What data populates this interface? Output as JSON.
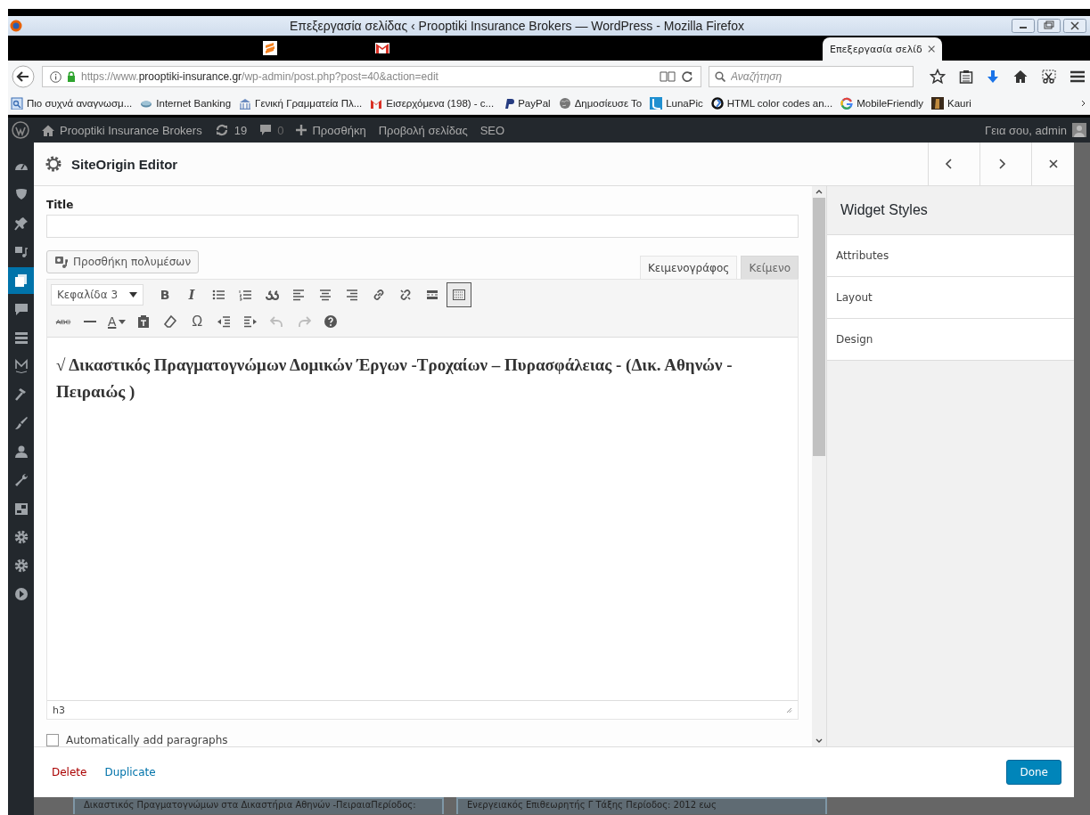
{
  "window": {
    "title": "Επεξεργασία σελίδας ‹ Prooptiki Insurance Brokers — WordPress - Mozilla Firefox"
  },
  "pinned_tabs": [
    {
      "kind": "sublime"
    },
    {
      "kind": "mail"
    }
  ],
  "tabs": [
    {
      "label": "Επεξεργασία σελίδ",
      "selected": true
    }
  ],
  "address_bar": {
    "url": "https://www.**prooptiki-insurance.gr**/wp-admin/post.php?post=40&action=edit"
  },
  "search": {
    "placeholder": "Αναζήτηση"
  },
  "bookmarks": [
    {
      "label": "Πιο συχνά αναγνωσμ...",
      "kind": "page"
    },
    {
      "label": "Internet Banking",
      "kind": "disk"
    },
    {
      "label": "Γενική Γραμματεία Πλ...",
      "kind": "building"
    },
    {
      "label": "Εισερχόμενα (198) - c...",
      "kind": "mail"
    },
    {
      "label": "PayPal",
      "kind": "paypal"
    },
    {
      "label": "Δημοσίευσε Το",
      "kind": "globe"
    },
    {
      "label": "LunaPic",
      "kind": "luna"
    },
    {
      "label": "HTML color codes an...",
      "kind": "ring"
    },
    {
      "label": "MobileFriendly",
      "kind": "google"
    },
    {
      "label": "Kauri",
      "kind": "photo"
    }
  ],
  "admin_bar": {
    "site": "Prooptiki Insurance Brokers",
    "updates": "19",
    "comments": "0",
    "new": "Προσθήκη",
    "view": "Προβολή σελίδας",
    "seo": "SEO",
    "greeting": "Γεια σου, admin"
  },
  "admin_menu": [
    {
      "kind": "gauge",
      "selected": false
    },
    {
      "kind": "shield",
      "selected": false
    },
    {
      "kind": "pin",
      "selected": false
    },
    {
      "kind": "media",
      "selected": false
    },
    {
      "kind": "pages",
      "selected": true
    },
    {
      "kind": "bubble",
      "selected": false
    },
    {
      "kind": "lines",
      "selected": false
    },
    {
      "kind": "letter",
      "selected": false
    },
    {
      "kind": "hammer",
      "selected": false
    },
    {
      "kind": "brush",
      "selected": false
    },
    {
      "kind": "user",
      "selected": false
    },
    {
      "kind": "wrench",
      "selected": false
    },
    {
      "kind": "box",
      "selected": false
    },
    {
      "kind": "gear",
      "selected": false
    },
    {
      "kind": "gear",
      "selected": false
    },
    {
      "kind": "play",
      "selected": false
    }
  ],
  "modal": {
    "title": "SiteOrigin Editor",
    "title_label": "Title",
    "add_media": "Προσθήκη πολυμέσων",
    "editor_tabs": [
      {
        "label": "Κειμενογράφος",
        "selected": true
      },
      {
        "label": "Κείμενο",
        "selected": false
      }
    ],
    "format_select": "Κεφαλίδα 3",
    "toolbar_rows": [
      [
        {
          "kind": "bold",
          "label": "B",
          "pressed": false,
          "disabled": false
        },
        {
          "kind": "italic",
          "label": "I",
          "pressed": false,
          "disabled": false
        },
        {
          "kind": "bullets",
          "pressed": false,
          "disabled": false
        },
        {
          "kind": "numbers",
          "pressed": false,
          "disabled": false
        },
        {
          "kind": "quote",
          "pressed": false,
          "disabled": false
        },
        {
          "kind": "align-left",
          "pressed": false,
          "disabled": false
        },
        {
          "kind": "align-center",
          "pressed": false,
          "disabled": false
        },
        {
          "kind": "align-right",
          "pressed": false,
          "disabled": false
        },
        {
          "kind": "link",
          "pressed": false,
          "disabled": false
        },
        {
          "kind": "unlink",
          "pressed": false,
          "disabled": false
        },
        {
          "kind": "more",
          "pressed": false,
          "disabled": false
        },
        {
          "kind": "keyboard",
          "pressed": true,
          "disabled": false
        }
      ],
      [
        {
          "kind": "strike",
          "label": "ABC",
          "pressed": false,
          "disabled": false
        },
        {
          "kind": "rule",
          "pressed": false,
          "disabled": false
        },
        {
          "kind": "color",
          "label": "A",
          "pressed": false,
          "disabled": false
        },
        {
          "kind": "paste",
          "pressed": false,
          "disabled": false
        },
        {
          "kind": "eraser",
          "pressed": false,
          "disabled": false
        },
        {
          "kind": "symbol",
          "label": "Ω",
          "pressed": false,
          "disabled": false
        },
        {
          "kind": "outdent",
          "pressed": false,
          "disabled": false
        },
        {
          "kind": "indent",
          "pressed": false,
          "disabled": false
        },
        {
          "kind": "undo",
          "pressed": false,
          "disabled": true
        },
        {
          "kind": "redo",
          "pressed": false,
          "disabled": true
        },
        {
          "kind": "help",
          "pressed": false,
          "disabled": false
        }
      ]
    ],
    "content": "√ Δικαστικός Πραγματογνώμων Δομικών Έργων -Τροχαίων – Πυρασφάλειας - (Δικ. Αθηνών - Πειραιώς )",
    "path": "h3",
    "auto_paragraphs": {
      "label": "Automatically add paragraphs",
      "checked": false
    },
    "styles_panel": {
      "title": "Widget Styles",
      "sections": [
        "Attributes",
        "Layout",
        "Design"
      ]
    },
    "footer": {
      "delete": "Delete",
      "duplicate": "Duplicate",
      "done": "Done"
    }
  },
  "background_cards": [
    "Δικαστικός Πραγματογνώμων στα Δικαστήρια Αθηνών -ΠειραιαΠερίοδος:",
    "Ενεργειακός Επιθεωρητής Γ Τάξης Περίοδος: 2012 εως"
  ]
}
